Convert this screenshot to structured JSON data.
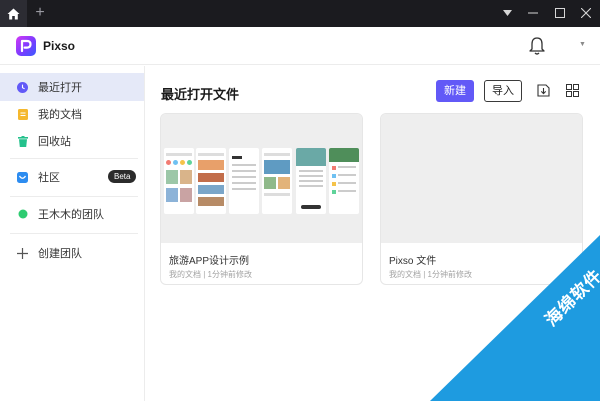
{
  "app": {
    "name": "Pixso",
    "new_tab_glyph": "+"
  },
  "sidebar": {
    "items": [
      {
        "label": "最近打开",
        "icon": "clock-icon"
      },
      {
        "label": "我的文档",
        "icon": "document-icon"
      },
      {
        "label": "回收站",
        "icon": "trash-icon"
      },
      {
        "label": "社区",
        "icon": "community-icon",
        "badge": "Beta"
      },
      {
        "label": "王木木的团队",
        "icon": "team-dot-icon"
      },
      {
        "label": "创建团队",
        "icon": "plus-icon"
      }
    ]
  },
  "main": {
    "title": "最近打开文件",
    "new_button": "新建",
    "import_button": "导入"
  },
  "files": [
    {
      "name": "旅游APP设计示例",
      "meta": "我的文档 | 1分钟前修改"
    },
    {
      "name": "Pixso 文件",
      "meta": "我的文档 | 1分钟前修改"
    }
  ],
  "watermark": {
    "text": "海绵软件"
  },
  "colors": {
    "accent": "#6259f7",
    "titlebar": "#1b1b1f",
    "active_item_bg": "#e5e9f8",
    "team_dot": "#2ecc71",
    "watermark": "#1e9be0"
  }
}
